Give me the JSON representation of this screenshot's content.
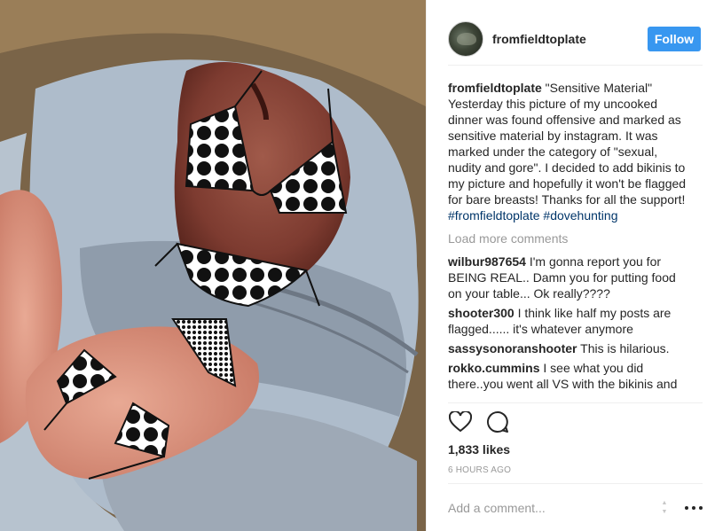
{
  "post": {
    "image_alt": "Plucked dove with bikini drawings",
    "username": "fromfieldtoplate",
    "follow_label": "Follow",
    "caption": {
      "user": "fromfieldtoplate",
      "text_parts": [
        "\"Sensitive Material\" Yesterday this picture of my uncooked dinner was found offensive and marked as sensitive material by instagram. It was marked under the category of \"sexual, nudity and gore\". I decided to add bikinis to my picture and hopefully it won't be flagged for bare breasts! Thanks for all the support! ",
        "#fromfieldtoplate",
        " ",
        "#dovehunting"
      ]
    },
    "load_more_label": "Load more comments",
    "comments": [
      {
        "user": "wilbur987654",
        "text": "I'm gonna report you for BEING REAL.. Damn you for putting food on your table... Ok really????"
      },
      {
        "user": "shooter300",
        "text": "I think like half my posts are flagged...... it's whatever anymore"
      },
      {
        "user": "sassysonoranshooter",
        "text": "This is hilarious."
      },
      {
        "user": "rokko.cummins",
        "text": "I see what you did there..you went all VS with the bikinis and"
      }
    ],
    "likes": "1,833 likes",
    "time": "6 HOURS AGO",
    "add_comment_placeholder": "Add a comment...",
    "icons": {
      "like": "heart-icon",
      "comment": "comment-bubble-icon",
      "more": "more-options-icon"
    },
    "colors": {
      "follow": "#3897f0",
      "hashtag": "#003569",
      "muted": "#999999"
    }
  }
}
